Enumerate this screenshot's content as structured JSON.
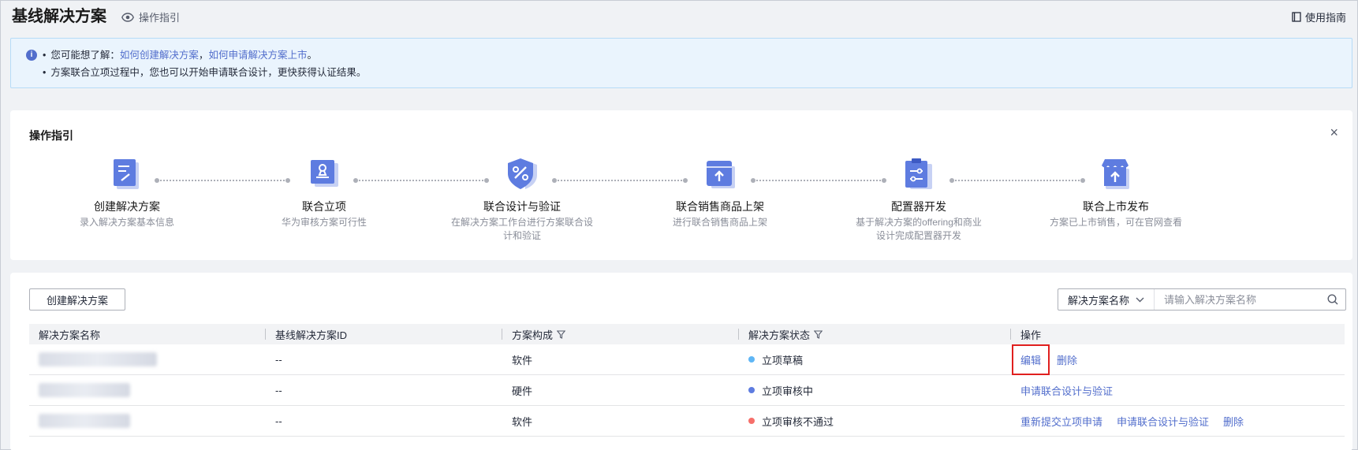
{
  "header": {
    "title": "基线解决方案",
    "guide_link": "操作指引",
    "user_guide": "使用指南"
  },
  "info": {
    "line1_prefix": "您可能想了解：",
    "link1": "如何创建解决方案",
    "comma": "，",
    "link2": "如何申请解决方案上市",
    "line1_suffix": "。",
    "line2": "方案联合立项过程中，您也可以开始申请联合设计，更快获得认证结果。"
  },
  "guide": {
    "title": "操作指引",
    "close": "×",
    "steps": [
      {
        "name": "创建解决方案",
        "desc": "录入解决方案基本信息",
        "icon": "document-edit-icon"
      },
      {
        "name": "联合立项",
        "desc": "华为审核方案可行性",
        "icon": "stamp-icon"
      },
      {
        "name": "联合设计与验证",
        "desc": "在解决方案工作台进行方案联合设计和验证",
        "icon": "shield-tools-icon"
      },
      {
        "name": "联合销售商品上架",
        "desc": "进行联合销售商品上架",
        "icon": "box-upload-icon"
      },
      {
        "name": "配置器开发",
        "desc": "基于解决方案的offering和商业设计完成配置器开发",
        "icon": "clipboard-settings-icon"
      },
      {
        "name": "联合上市发布",
        "desc": "方案已上市销售，可在官网查看",
        "icon": "store-upload-icon"
      }
    ]
  },
  "toolbar": {
    "create_label": "创建解决方案",
    "search_select": "解决方案名称",
    "search_placeholder": "请输入解决方案名称"
  },
  "table": {
    "columns": [
      "解决方案名称",
      "基线解决方案ID",
      "方案构成",
      "解决方案状态",
      "操作"
    ],
    "rows": [
      {
        "id": "--",
        "composition": "软件",
        "status": "立项草稿",
        "status_color": "#5fb6f5",
        "actions": [
          "编辑",
          "删除"
        ]
      },
      {
        "id": "--",
        "composition": "硬件",
        "status": "立项审核中",
        "status_color": "#5e7ce0",
        "actions": [
          "申请联合设计与验证"
        ]
      },
      {
        "id": "--",
        "composition": "软件",
        "status": "立项审核不通过",
        "status_color": "#f66f6a",
        "actions": [
          "重新提交立项申请",
          "申请联合设计与验证",
          "删除"
        ]
      }
    ]
  },
  "colors": {
    "link": "#526ecc",
    "highlight_border": "#e0201f",
    "icon_primary": "#5e7ce0"
  }
}
